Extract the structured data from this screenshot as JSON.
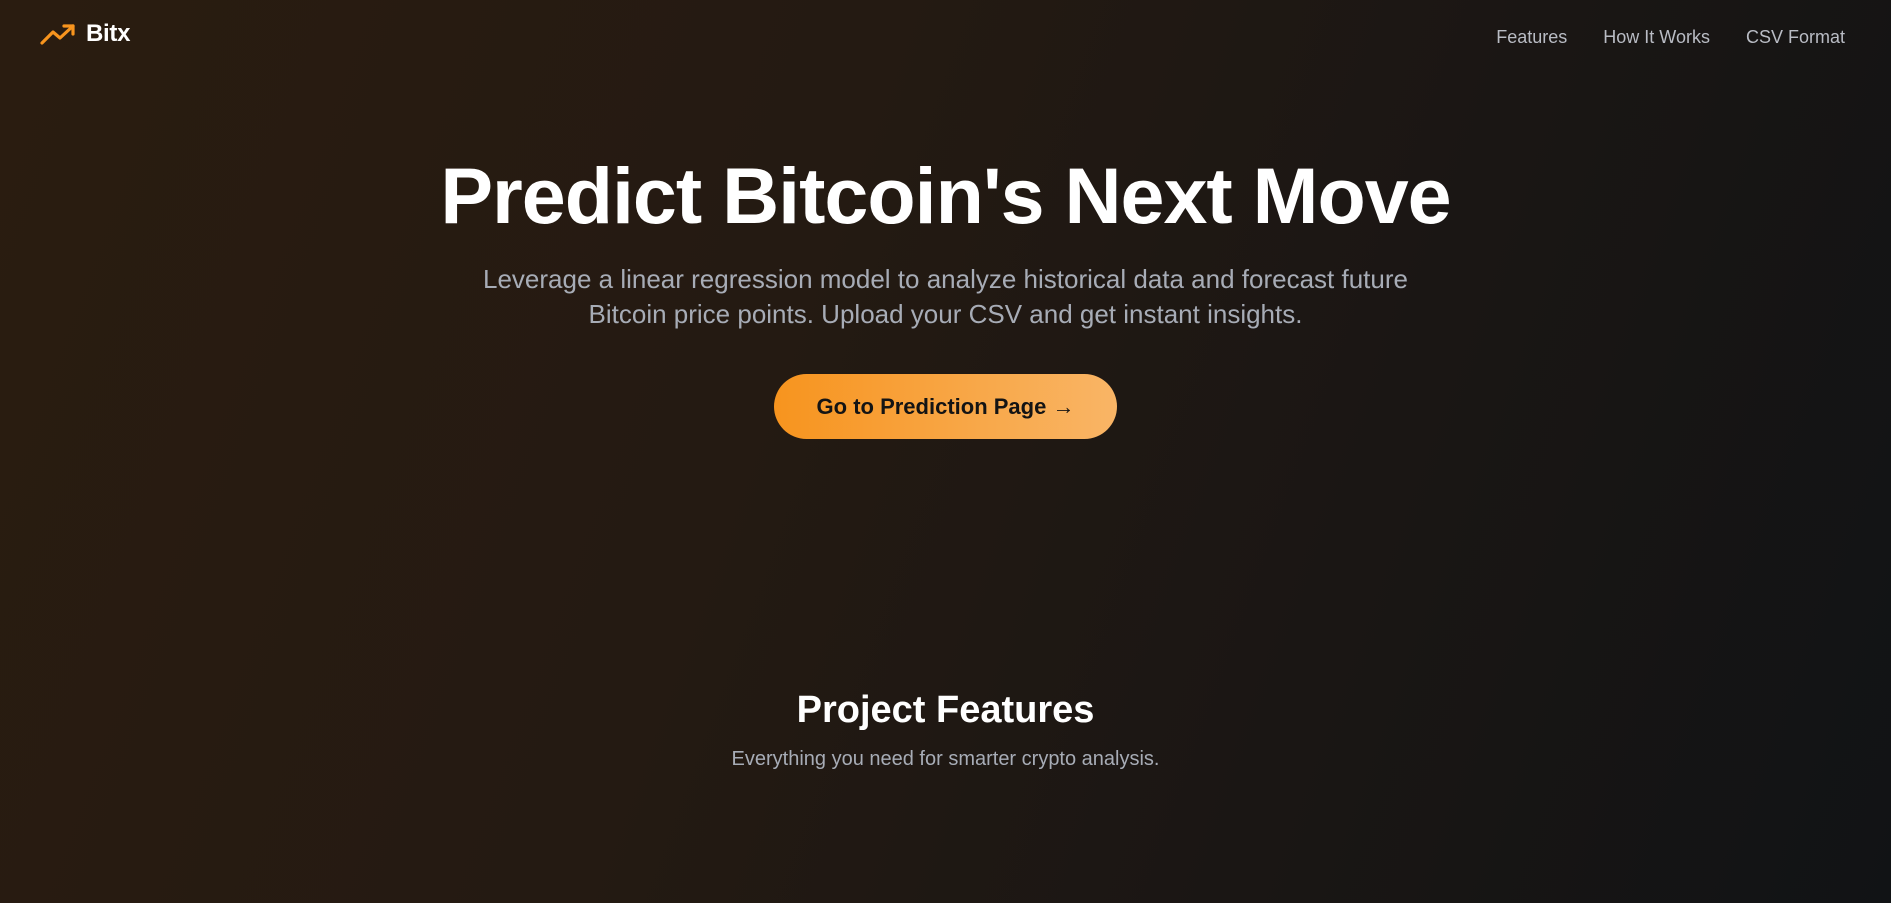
{
  "brand": {
    "name": "Bitx",
    "icon": "trending-up-icon",
    "accent_color": "#f7941e"
  },
  "nav": {
    "items": [
      {
        "label": "Features"
      },
      {
        "label": "How It Works"
      },
      {
        "label": "CSV Format"
      }
    ]
  },
  "hero": {
    "title": "Predict Bitcoin's Next Move",
    "subtitle": "Leverage a linear regression model to analyze historical data and forecast future Bitcoin price points. Upload your CSV and get instant insights.",
    "cta_label": "Go to Prediction Page →"
  },
  "features": {
    "title": "Project Features",
    "subtitle": "Everything you need for smarter crypto analysis."
  }
}
